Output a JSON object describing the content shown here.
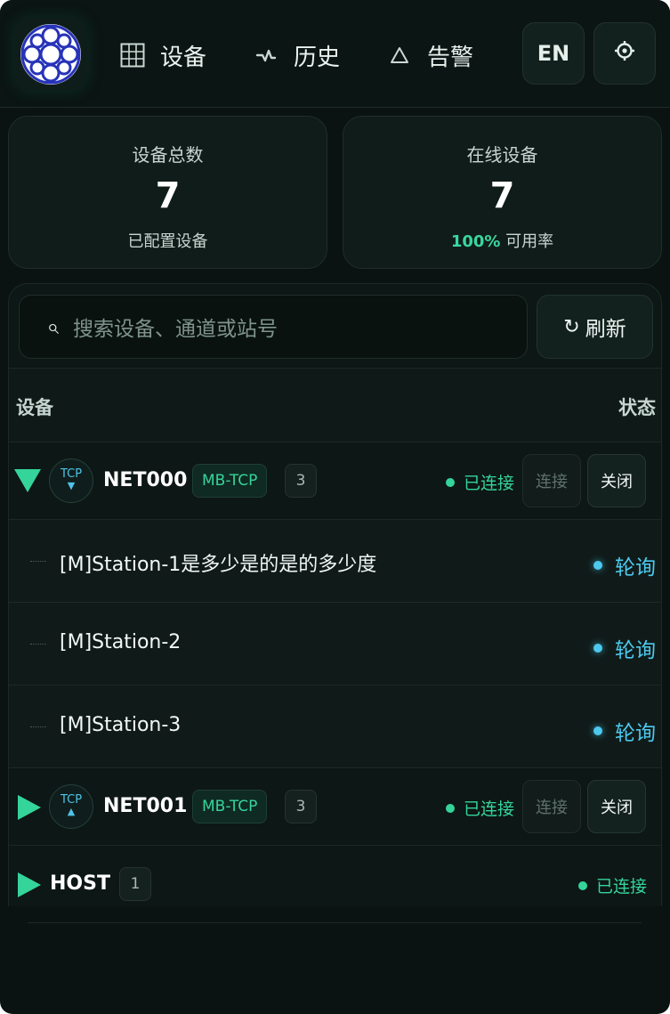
{
  "header": {
    "nav": [
      {
        "icon": "grid-icon",
        "label": "设备"
      },
      {
        "icon": "activity-icon",
        "label": "历史"
      },
      {
        "icon": "warning-icon",
        "label": "告警"
      }
    ],
    "lang_button": "EN",
    "settings_icon": "gear-icon"
  },
  "stats": {
    "total": {
      "title": "设备总数",
      "value": "7",
      "subtitle": "已配置设备"
    },
    "online": {
      "title": "在线设备",
      "value": "7",
      "rate": "100%",
      "subtitle": "可用率"
    }
  },
  "search": {
    "placeholder": "搜索设备、通道或站号",
    "refresh_label": "刷新"
  },
  "table": {
    "col_device": "设备",
    "col_status": "状态",
    "devices": [
      {
        "name": "NET000",
        "tcp": "TCP",
        "tcp_arrow": "▼",
        "protocol": "MB-TCP",
        "count": "3",
        "status": "已连接",
        "connect_label": "连接",
        "close_label": "关闭",
        "expanded": true,
        "stations": [
          {
            "name": "[M]Station-1是多少是的是的多少度",
            "status": "轮询"
          },
          {
            "name": "[M]Station-2",
            "status": "轮询"
          },
          {
            "name": "[M]Station-3",
            "status": "轮询"
          }
        ]
      },
      {
        "name": "NET001",
        "tcp": "TCP",
        "tcp_arrow": "▲",
        "protocol": "MB-TCP",
        "count": "3",
        "status": "已连接",
        "connect_label": "连接",
        "close_label": "关闭",
        "expanded": false
      },
      {
        "name": "HOST",
        "count": "1",
        "status": "已连接",
        "expanded": false
      }
    ]
  },
  "colors": {
    "background": "#0a1311",
    "accent_green": "#34d49b",
    "accent_blue": "#4cc9ef",
    "logo_blue": "#2733b8"
  }
}
